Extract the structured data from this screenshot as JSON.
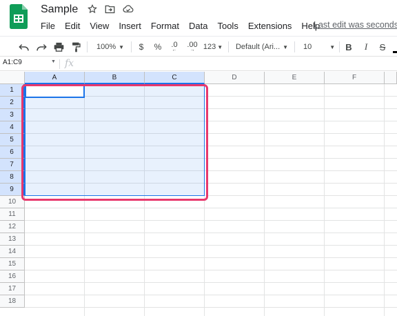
{
  "app": {
    "doc_title": "Sample",
    "last_edit": "Last edit was seconds ago",
    "icons": [
      "star-icon",
      "move-to-folder-icon",
      "cloud-status-icon"
    ],
    "brand_color": "#0f9d58"
  },
  "menu": [
    "File",
    "Edit",
    "View",
    "Insert",
    "Format",
    "Data",
    "Tools",
    "Extensions",
    "Help"
  ],
  "toolbar": {
    "zoom": "100%",
    "currency": "$",
    "percent": "%",
    "decrease_decimal": ".0",
    "increase_decimal": ".00",
    "number_format": "123",
    "font_family": "Default (Ari...",
    "font_size": "10",
    "bold": "B",
    "italic": "I",
    "strikethrough": "S"
  },
  "formula_bar": {
    "name_box": "A1:C9",
    "fx_label": "fx",
    "value": ""
  },
  "grid": {
    "columns": [
      "A",
      "B",
      "C",
      "D",
      "E",
      "F"
    ],
    "selected_columns": [
      "A",
      "B",
      "C"
    ],
    "rows": [
      "1",
      "2",
      "3",
      "4",
      "5",
      "6",
      "7",
      "8",
      "9",
      "10",
      "11",
      "12",
      "13",
      "14",
      "15",
      "16",
      "17",
      "18"
    ],
    "selected_rows": [
      "1",
      "2",
      "3",
      "4",
      "5",
      "6",
      "7",
      "8",
      "9"
    ],
    "selection_range": "A1:C9",
    "active_cell": "A1",
    "selection_color": "#1a73e8",
    "highlight_color": "#e8386d"
  }
}
